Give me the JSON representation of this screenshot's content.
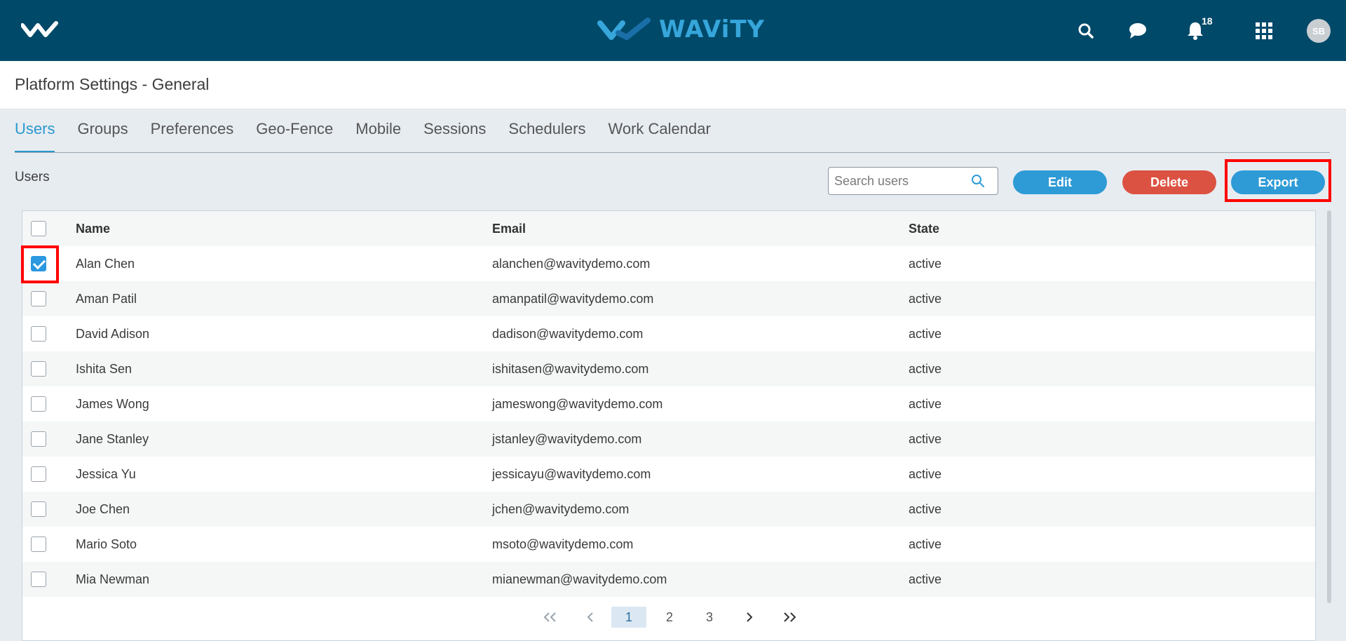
{
  "header": {
    "brand": "WAViTY",
    "notification_count": "18",
    "avatar_initials": "SB"
  },
  "page": {
    "title": "Platform Settings - General",
    "section_label": "Users"
  },
  "tabs": [
    {
      "label": "Users",
      "active": true
    },
    {
      "label": "Groups"
    },
    {
      "label": "Preferences"
    },
    {
      "label": "Geo-Fence"
    },
    {
      "label": "Mobile"
    },
    {
      "label": "Sessions"
    },
    {
      "label": "Schedulers"
    },
    {
      "label": "Work Calendar"
    }
  ],
  "toolbar": {
    "search_placeholder": "Search users",
    "edit_label": "Edit",
    "delete_label": "Delete",
    "export_label": "Export"
  },
  "table": {
    "columns": {
      "name": "Name",
      "email": "Email",
      "state": "State"
    },
    "rows": [
      {
        "name": "Alan Chen",
        "email": "alanchen@wavitydemo.com",
        "state": "active",
        "checked": true
      },
      {
        "name": "Aman Patil",
        "email": "amanpatil@wavitydemo.com",
        "state": "active"
      },
      {
        "name": "David Adison",
        "email": "dadison@wavitydemo.com",
        "state": "active"
      },
      {
        "name": "Ishita Sen",
        "email": "ishitasen@wavitydemo.com",
        "state": "active"
      },
      {
        "name": "James Wong",
        "email": "jameswong@wavitydemo.com",
        "state": "active"
      },
      {
        "name": "Jane Stanley",
        "email": "jstanley@wavitydemo.com",
        "state": "active"
      },
      {
        "name": "Jessica Yu",
        "email": "jessicayu@wavitydemo.com",
        "state": "active"
      },
      {
        "name": "Joe Chen",
        "email": "jchen@wavitydemo.com",
        "state": "active"
      },
      {
        "name": "Mario Soto",
        "email": "msoto@wavitydemo.com",
        "state": "active"
      },
      {
        "name": "Mia Newman",
        "email": "mianewman@wavitydemo.com",
        "state": "active"
      }
    ]
  },
  "pagination": {
    "pages": [
      "1",
      "2",
      "3"
    ],
    "current": "1"
  },
  "colors": {
    "topbar": "#004969",
    "accent": "#2e9bd6",
    "danger": "#dc5242",
    "highlight": "#ff0000"
  }
}
